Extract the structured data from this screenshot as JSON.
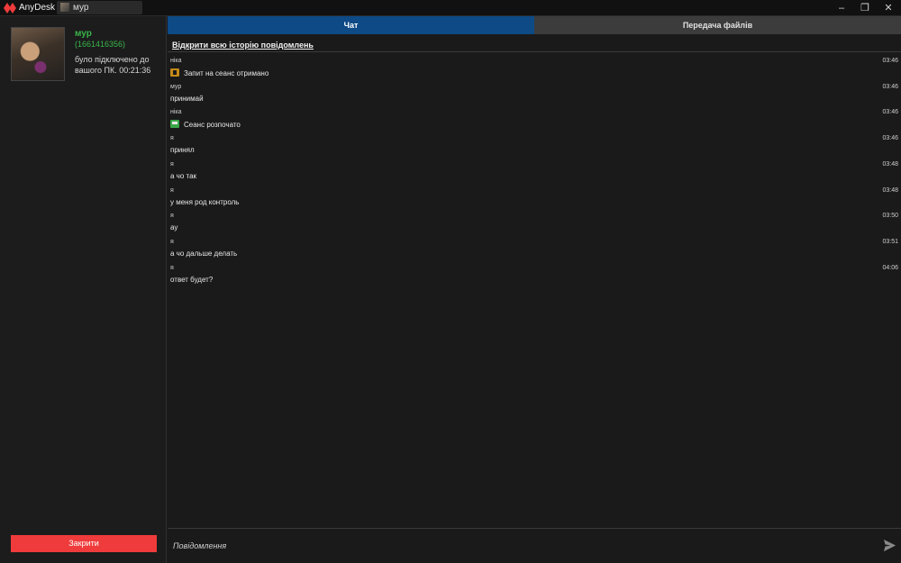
{
  "titlebar": {
    "app_name": "AnyDesk",
    "session_tab": "мур",
    "controls": [
      "–",
      "❐",
      "✕"
    ]
  },
  "sidebar": {
    "peer_name": "мур",
    "peer_id": "(1661416356)",
    "status": "було підключено до вашого ПК. 00:21:36",
    "close_button": "Закрити"
  },
  "tabs": {
    "chat": "Чат",
    "file_transfer": "Передача файлів"
  },
  "chat": {
    "history_link": "Відкрити всю історію повідомлень",
    "messages": [
      {
        "sender": "ніка",
        "time": "03:46",
        "text": "Запит на сеанс отримано",
        "icon": "session-request-icon"
      },
      {
        "sender": "мур",
        "time": "03:46",
        "text": "принимай"
      },
      {
        "sender": "ніка",
        "time": "03:46",
        "text": "Сеанс розпочато",
        "icon": "session-started-icon"
      },
      {
        "sender": "я",
        "time": "03:46",
        "text": "принял"
      },
      {
        "sender": "я",
        "time": "03:48",
        "text": "а чо так"
      },
      {
        "sender": "я",
        "time": "03:48",
        "text": "у меня род контроль"
      },
      {
        "sender": "я",
        "time": "03:50",
        "text": "ау"
      },
      {
        "sender": "я",
        "time": "03:51",
        "text": "а чо дальше делать"
      },
      {
        "sender": "я",
        "time": "04:06",
        "text": "ответ будет?"
      }
    ],
    "input_placeholder": "Повідомлення"
  },
  "colors": {
    "accent_blue": "#0d4a86",
    "brand_red": "#ef3b3b",
    "online_green": "#39b54a"
  }
}
